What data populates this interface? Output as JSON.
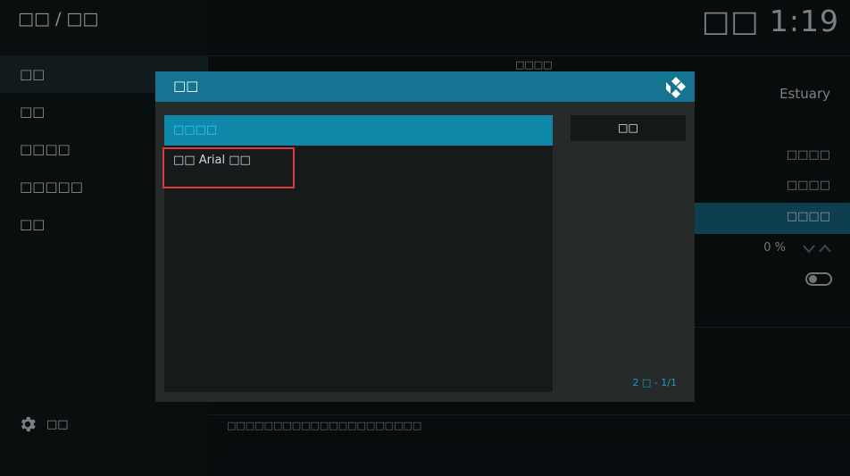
{
  "header": {
    "breadcrumb": "□□ / □□",
    "clock": "□□ 1:19"
  },
  "sidebar": {
    "items": [
      {
        "label": "□□",
        "active": true
      },
      {
        "label": "□□"
      },
      {
        "label": "□□□□"
      },
      {
        "label": "□□□□□"
      },
      {
        "label": "□□"
      }
    ],
    "settings_label": "□□"
  },
  "settings": {
    "section_title": "□□□□",
    "skin_value": "Estuary",
    "row1_value": "□□□□",
    "row2_value": "□□□□",
    "row3_value": "□□□□",
    "zoom_value": "0 %",
    "description": "□□□□□□□□□□□□□□□□□□□□□"
  },
  "dialog": {
    "title": "□□",
    "items": [
      {
        "label": "□□□□",
        "selected": true
      },
      {
        "label": "□□ Arial □□",
        "selected": false
      }
    ],
    "ok_label": "□□",
    "page_count": "2 □ - 1/1"
  },
  "colors": {
    "accent": "#147491",
    "selected_item": "#0e87a9",
    "highlight_box": "#e0383b"
  }
}
